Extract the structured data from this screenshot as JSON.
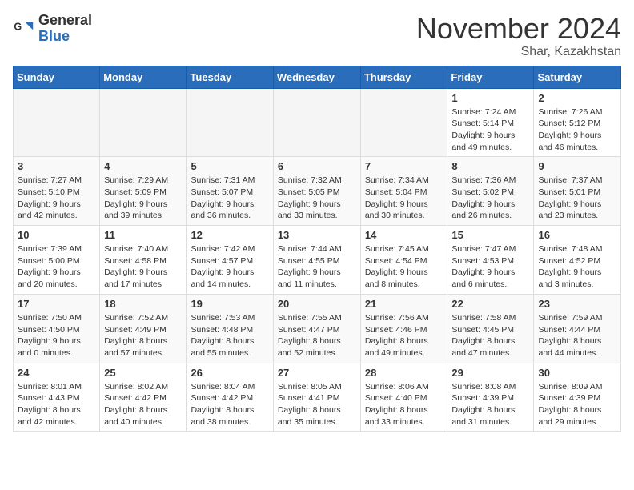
{
  "header": {
    "logo_general": "General",
    "logo_blue": "Blue",
    "month_title": "November 2024",
    "location": "Shar, Kazakhstan"
  },
  "weekdays": [
    "Sunday",
    "Monday",
    "Tuesday",
    "Wednesday",
    "Thursday",
    "Friday",
    "Saturday"
  ],
  "weeks": [
    [
      {
        "day": "",
        "info": ""
      },
      {
        "day": "",
        "info": ""
      },
      {
        "day": "",
        "info": ""
      },
      {
        "day": "",
        "info": ""
      },
      {
        "day": "",
        "info": ""
      },
      {
        "day": "1",
        "info": "Sunrise: 7:24 AM\nSunset: 5:14 PM\nDaylight: 9 hours\nand 49 minutes."
      },
      {
        "day": "2",
        "info": "Sunrise: 7:26 AM\nSunset: 5:12 PM\nDaylight: 9 hours\nand 46 minutes."
      }
    ],
    [
      {
        "day": "3",
        "info": "Sunrise: 7:27 AM\nSunset: 5:10 PM\nDaylight: 9 hours\nand 42 minutes."
      },
      {
        "day": "4",
        "info": "Sunrise: 7:29 AM\nSunset: 5:09 PM\nDaylight: 9 hours\nand 39 minutes."
      },
      {
        "day": "5",
        "info": "Sunrise: 7:31 AM\nSunset: 5:07 PM\nDaylight: 9 hours\nand 36 minutes."
      },
      {
        "day": "6",
        "info": "Sunrise: 7:32 AM\nSunset: 5:05 PM\nDaylight: 9 hours\nand 33 minutes."
      },
      {
        "day": "7",
        "info": "Sunrise: 7:34 AM\nSunset: 5:04 PM\nDaylight: 9 hours\nand 30 minutes."
      },
      {
        "day": "8",
        "info": "Sunrise: 7:36 AM\nSunset: 5:02 PM\nDaylight: 9 hours\nand 26 minutes."
      },
      {
        "day": "9",
        "info": "Sunrise: 7:37 AM\nSunset: 5:01 PM\nDaylight: 9 hours\nand 23 minutes."
      }
    ],
    [
      {
        "day": "10",
        "info": "Sunrise: 7:39 AM\nSunset: 5:00 PM\nDaylight: 9 hours\nand 20 minutes."
      },
      {
        "day": "11",
        "info": "Sunrise: 7:40 AM\nSunset: 4:58 PM\nDaylight: 9 hours\nand 17 minutes."
      },
      {
        "day": "12",
        "info": "Sunrise: 7:42 AM\nSunset: 4:57 PM\nDaylight: 9 hours\nand 14 minutes."
      },
      {
        "day": "13",
        "info": "Sunrise: 7:44 AM\nSunset: 4:55 PM\nDaylight: 9 hours\nand 11 minutes."
      },
      {
        "day": "14",
        "info": "Sunrise: 7:45 AM\nSunset: 4:54 PM\nDaylight: 9 hours\nand 8 minutes."
      },
      {
        "day": "15",
        "info": "Sunrise: 7:47 AM\nSunset: 4:53 PM\nDaylight: 9 hours\nand 6 minutes."
      },
      {
        "day": "16",
        "info": "Sunrise: 7:48 AM\nSunset: 4:52 PM\nDaylight: 9 hours\nand 3 minutes."
      }
    ],
    [
      {
        "day": "17",
        "info": "Sunrise: 7:50 AM\nSunset: 4:50 PM\nDaylight: 9 hours\nand 0 minutes."
      },
      {
        "day": "18",
        "info": "Sunrise: 7:52 AM\nSunset: 4:49 PM\nDaylight: 8 hours\nand 57 minutes."
      },
      {
        "day": "19",
        "info": "Sunrise: 7:53 AM\nSunset: 4:48 PM\nDaylight: 8 hours\nand 55 minutes."
      },
      {
        "day": "20",
        "info": "Sunrise: 7:55 AM\nSunset: 4:47 PM\nDaylight: 8 hours\nand 52 minutes."
      },
      {
        "day": "21",
        "info": "Sunrise: 7:56 AM\nSunset: 4:46 PM\nDaylight: 8 hours\nand 49 minutes."
      },
      {
        "day": "22",
        "info": "Sunrise: 7:58 AM\nSunset: 4:45 PM\nDaylight: 8 hours\nand 47 minutes."
      },
      {
        "day": "23",
        "info": "Sunrise: 7:59 AM\nSunset: 4:44 PM\nDaylight: 8 hours\nand 44 minutes."
      }
    ],
    [
      {
        "day": "24",
        "info": "Sunrise: 8:01 AM\nSunset: 4:43 PM\nDaylight: 8 hours\nand 42 minutes."
      },
      {
        "day": "25",
        "info": "Sunrise: 8:02 AM\nSunset: 4:42 PM\nDaylight: 8 hours\nand 40 minutes."
      },
      {
        "day": "26",
        "info": "Sunrise: 8:04 AM\nSunset: 4:42 PM\nDaylight: 8 hours\nand 38 minutes."
      },
      {
        "day": "27",
        "info": "Sunrise: 8:05 AM\nSunset: 4:41 PM\nDaylight: 8 hours\nand 35 minutes."
      },
      {
        "day": "28",
        "info": "Sunrise: 8:06 AM\nSunset: 4:40 PM\nDaylight: 8 hours\nand 33 minutes."
      },
      {
        "day": "29",
        "info": "Sunrise: 8:08 AM\nSunset: 4:39 PM\nDaylight: 8 hours\nand 31 minutes."
      },
      {
        "day": "30",
        "info": "Sunrise: 8:09 AM\nSunset: 4:39 PM\nDaylight: 8 hours\nand 29 minutes."
      }
    ]
  ]
}
